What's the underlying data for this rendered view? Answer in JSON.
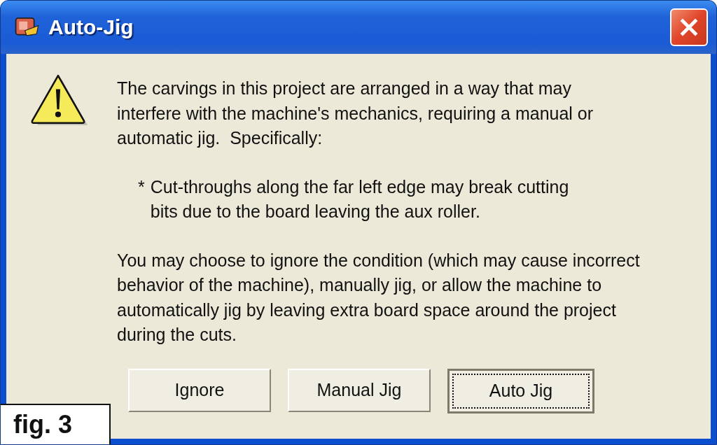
{
  "window": {
    "title": "Auto-Jig"
  },
  "message": {
    "intro": [
      "The carvings in this project are arranged in a way that may",
      "interfere with the machine's mechanics, requiring a manual or",
      "automatic jig.  Specifically:"
    ],
    "bullet": {
      "marker": "*",
      "lines": [
        "Cut-throughs along the far left edge may break cutting",
        "bits due to the board leaving the aux roller."
      ]
    },
    "outro": [
      "You may choose to ignore the condition (which may cause incorrect",
      "behavior of the machine), manually jig, or allow the machine to",
      "automatically jig by leaving extra board space around the project",
      "during the cuts."
    ]
  },
  "buttons": [
    {
      "label": "Ignore",
      "focused": false
    },
    {
      "label": "Manual Jig",
      "focused": false
    },
    {
      "label": "Auto Jig",
      "focused": true
    }
  ],
  "figure_label": "fig. 3"
}
